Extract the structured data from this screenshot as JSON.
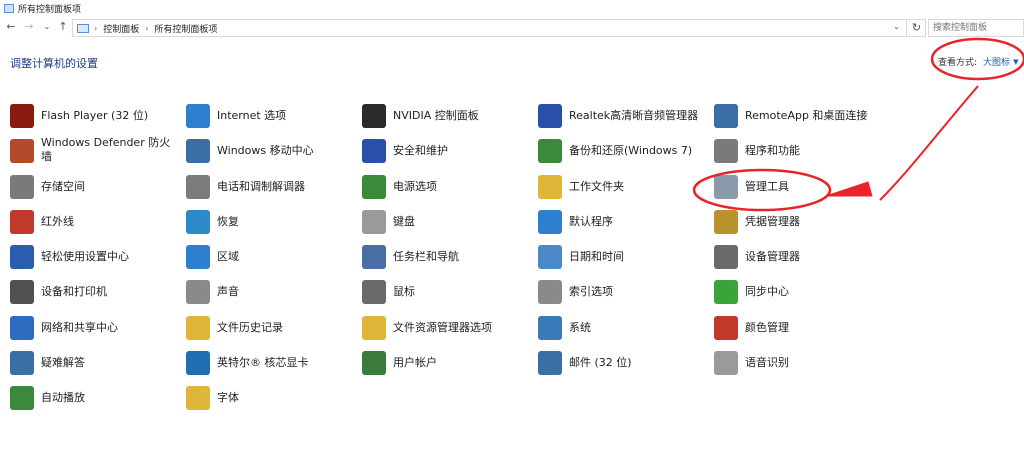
{
  "window": {
    "title": "所有控制面板项"
  },
  "address": {
    "crumbs": [
      "控制面板",
      "所有控制面板项"
    ],
    "search_placeholder": "搜索控制面板"
  },
  "header": {
    "heading": "调整计算机的设置",
    "view_by_label": "查看方式:",
    "view_by_value": "大图标"
  },
  "items": [
    {
      "label": "Flash Player (32 位)",
      "icon": "flash-icon",
      "color": "#8b1a10"
    },
    {
      "label": "Windows Defender 防火墙",
      "icon": "firewall-icon",
      "color": "#b34a2a"
    },
    {
      "label": "存储空间",
      "icon": "storage-icon",
      "color": "#7a7a7a"
    },
    {
      "label": "红外线",
      "icon": "infrared-icon",
      "color": "#c0392b"
    },
    {
      "label": "轻松使用设置中心",
      "icon": "ease-of-access-icon",
      "color": "#2a5db0"
    },
    {
      "label": "设备和打印机",
      "icon": "printer-icon",
      "color": "#505050"
    },
    {
      "label": "网络和共享中心",
      "icon": "network-icon",
      "color": "#2c6bbf"
    },
    {
      "label": "疑难解答",
      "icon": "troubleshoot-icon",
      "color": "#3a6ea5"
    },
    {
      "label": "自动播放",
      "icon": "autoplay-icon",
      "color": "#3b8a3b"
    },
    {
      "label": "Internet 选项",
      "icon": "internet-icon",
      "color": "#2f7fd1"
    },
    {
      "label": "Windows 移动中心",
      "icon": "mobility-icon",
      "color": "#3a6ea5"
    },
    {
      "label": "电话和调制解调器",
      "icon": "phone-icon",
      "color": "#7b7b7b"
    },
    {
      "label": "恢复",
      "icon": "recovery-icon",
      "color": "#2c8acb"
    },
    {
      "label": "区域",
      "icon": "region-icon",
      "color": "#2f7fd1"
    },
    {
      "label": "声音",
      "icon": "sound-icon",
      "color": "#8a8a8a"
    },
    {
      "label": "文件历史记录",
      "icon": "file-history-icon",
      "color": "#e0b63a"
    },
    {
      "label": "英特尔® 核芯显卡",
      "icon": "intel-graphics-icon",
      "color": "#1f6fb5"
    },
    {
      "label": "字体",
      "icon": "fonts-icon",
      "color": "#e0b63a"
    },
    {
      "label": "NVIDIA 控制面板",
      "icon": "nvidia-icon",
      "color": "#2b2b2b"
    },
    {
      "label": "安全和维护",
      "icon": "security-flag-icon",
      "color": "#2a4fa8"
    },
    {
      "label": "电源选项",
      "icon": "power-icon",
      "color": "#3a8a3a"
    },
    {
      "label": "键盘",
      "icon": "keyboard-icon",
      "color": "#9a9a9a"
    },
    {
      "label": "任务栏和导航",
      "icon": "taskbar-icon",
      "color": "#4a6fa5"
    },
    {
      "label": "鼠标",
      "icon": "mouse-icon",
      "color": "#6a6a6a"
    },
    {
      "label": "文件资源管理器选项",
      "icon": "folder-options-icon",
      "color": "#e0b63a"
    },
    {
      "label": "用户帐户",
      "icon": "user-accounts-icon",
      "color": "#3a7a3a"
    },
    {
      "label": "Realtek高清晰音频管理器",
      "icon": "realtek-icon",
      "color": "#2a4fa8"
    },
    {
      "label": "备份和还原(Windows 7)",
      "icon": "backup-icon",
      "color": "#3a8a3a"
    },
    {
      "label": "工作文件夹",
      "icon": "work-folders-icon",
      "color": "#e0b63a"
    },
    {
      "label": "默认程序",
      "icon": "default-programs-icon",
      "color": "#2f7fd1"
    },
    {
      "label": "日期和时间",
      "icon": "date-time-icon",
      "color": "#4a8ac9"
    },
    {
      "label": "索引选项",
      "icon": "indexing-icon",
      "color": "#8a8a8a"
    },
    {
      "label": "系统",
      "icon": "system-icon",
      "color": "#3a7ab8"
    },
    {
      "label": "邮件 (32 位)",
      "icon": "mail-icon",
      "color": "#3a6ea5"
    },
    {
      "label": "RemoteApp 和桌面连接",
      "icon": "remoteapp-icon",
      "color": "#3a6ea5"
    },
    {
      "label": "程序和功能",
      "icon": "programs-icon",
      "color": "#7a7a7a"
    },
    {
      "label": "管理工具",
      "icon": "admin-tools-icon",
      "color": "#8a9aaa"
    },
    {
      "label": "凭据管理器",
      "icon": "credential-icon",
      "color": "#b8922a"
    },
    {
      "label": "设备管理器",
      "icon": "device-manager-icon",
      "color": "#6a6a6a"
    },
    {
      "label": "同步中心",
      "icon": "sync-icon",
      "color": "#3aa43a"
    },
    {
      "label": "颜色管理",
      "icon": "color-management-icon",
      "color": "#c0392b"
    },
    {
      "label": "语音识别",
      "icon": "microphone-icon",
      "color": "#9a9a9a"
    }
  ],
  "annotation": {
    "color": "#e8232a"
  }
}
